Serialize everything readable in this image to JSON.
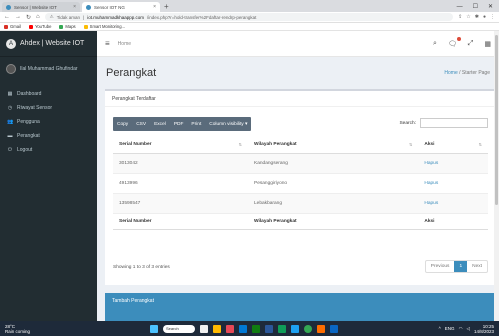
{
  "browser": {
    "tabs": [
      {
        "label": "Sensor | Website IOT",
        "active": false
      },
      {
        "label": "Sensor IOT NG",
        "active": true
      }
    ],
    "url_prefix": "Tidak aman",
    "url_host": "iot.muhammadkhaappp.com",
    "url_path": "/index.php?r=hold-transfer%2Fdaftar-rendrp-perangkat",
    "bookmarks": [
      {
        "label": "Gmail",
        "color": "#d93025"
      },
      {
        "label": "YouTube",
        "color": "#ff0000"
      },
      {
        "label": "Maps",
        "color": "#34a853"
      },
      {
        "label": "Smart Monitoring...",
        "color": "#fbbc04"
      }
    ]
  },
  "app": {
    "brand": "Ahdex | Website IOT",
    "user": "Ilal Muhammad Ghufindar",
    "menu": [
      {
        "label": "Dashboard",
        "icon": "dashboard-icon",
        "glyph": "▦"
      },
      {
        "label": "Riwayat Sensor",
        "icon": "history-icon",
        "glyph": "◷"
      },
      {
        "label": "Pengguna",
        "icon": "users-icon",
        "glyph": "👥"
      },
      {
        "label": "Perangkat",
        "icon": "device-icon",
        "glyph": "▬"
      },
      {
        "label": "Logout",
        "icon": "logout-icon",
        "glyph": "⏻"
      }
    ],
    "topnav": {
      "crumb": "Home"
    },
    "page_title": "Perangkat",
    "breadcrumb": {
      "home": "Home",
      "current": "Starter Page"
    },
    "box_title": "Perangkat Terdaftar",
    "toolbar": [
      "Copy",
      "CSV",
      "Excel",
      "PDF",
      "Print",
      "Column visibility ▾"
    ],
    "search_label": "Search:",
    "table": {
      "columns": [
        "Serial Number",
        "Wilayah Perangkat",
        "Aksi"
      ],
      "rows": [
        {
          "serial": "3013042",
          "wilayah": "Kandangserang",
          "aksi": "Hapus"
        },
        {
          "serial": "4913996",
          "wilayah": "Pesanggiriyono",
          "aksi": "Hapus"
        },
        {
          "serial": "13598547",
          "wilayah": "Lebakbarang",
          "aksi": "Hapus"
        }
      ]
    },
    "info": "Showing 1 to 3 of 3 entries",
    "pager": {
      "prev": "Previous",
      "page": "1",
      "next": "Next"
    },
    "add_box_title": "Tambah Perangkat"
  },
  "taskbar": {
    "weather_temp": "28°C",
    "weather_desc": "Rain coming",
    "search": "Search",
    "lang": "ENG",
    "time": "10:25",
    "date": "14/8/2023"
  }
}
